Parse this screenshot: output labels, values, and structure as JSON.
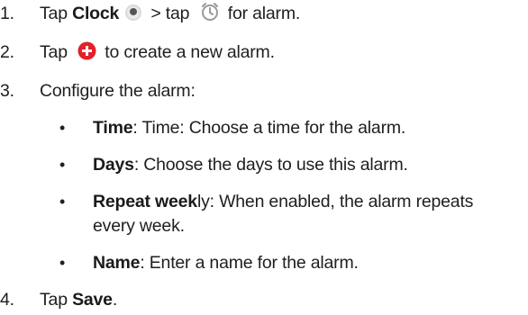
{
  "steps": [
    {
      "number": "1.",
      "pre": "Tap ",
      "bold": "Clock",
      "mid": " > tap ",
      "post": " for alarm.",
      "icons": [
        "clock-app-icon",
        "alarm-clock-icon"
      ]
    },
    {
      "number": "2.",
      "pre": "Tap ",
      "post": " to create a new alarm.",
      "icons": [
        "add-circle-icon"
      ]
    },
    {
      "number": "3.",
      "text": "Configure the alarm:"
    },
    {
      "number": "4.",
      "pre": "Tap ",
      "bold": "Save",
      "post": "."
    }
  ],
  "sub_items": [
    {
      "bullet": "•",
      "bold": "Time",
      "text": ": Time: Choose a time for the alarm."
    },
    {
      "bullet": "•",
      "bold": "Days",
      "text": ": Choose the days to use this alarm."
    },
    {
      "bullet": "•",
      "bold": "Repeat week",
      "text": "ly: When enabled, the alarm repeats",
      "continuation": "every week."
    },
    {
      "bullet": "•",
      "bold": "Name",
      "text": ": Enter a name for the alarm."
    }
  ],
  "colors": {
    "add_icon": "#e4202a",
    "clock_icon_bg": "#c8c8c8",
    "alarm_icon": "#9a9a9a"
  }
}
